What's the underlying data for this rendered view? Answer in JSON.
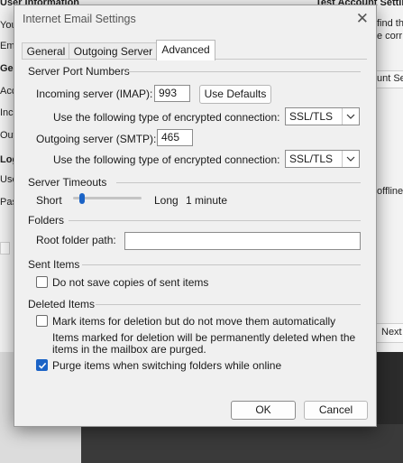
{
  "background": {
    "left_fragments": [
      "Your",
      "Emai",
      "Gene",
      "Acco",
      "Inco",
      "Outg",
      "Logo",
      "User",
      "Pass"
    ],
    "top_left_text": "User Information",
    "top_right_text": "Test Account Setting",
    "right_fragments": [
      "find tha",
      "e corr",
      "unt Sett",
      "offline"
    ],
    "next_button": "Next"
  },
  "dialog": {
    "title": "Internet Email Settings",
    "close_symbol": "✕",
    "tabs": [
      "General",
      "Outgoing Server",
      "Advanced"
    ],
    "active_tab": "Advanced",
    "server_ports": {
      "heading": "Server Port Numbers",
      "incoming_label": "Incoming server (IMAP):",
      "incoming_value": "993",
      "use_defaults": "Use Defaults",
      "encryption_label": "Use the following type of encrypted connection:",
      "incoming_encryption": "SSL/TLS",
      "outgoing_label": "Outgoing server (SMTP):",
      "outgoing_value": "465",
      "outgoing_encryption": "SSL/TLS"
    },
    "timeouts": {
      "heading": "Server Timeouts",
      "short": "Short",
      "long": "Long",
      "value": "1 minute",
      "slider_level": 0.1
    },
    "folders": {
      "heading": "Folders",
      "root_label": "Root folder path:",
      "root_value": ""
    },
    "sent_items": {
      "heading": "Sent Items",
      "dont_save_label": "Do not save copies of sent items",
      "dont_save_checked": false
    },
    "deleted_items": {
      "heading": "Deleted Items",
      "mark_label": "Mark items for deletion but do not move them automatically",
      "mark_checked": false,
      "note_line1": "Items marked for deletion will be permanently deleted when the",
      "note_line2": "items in the mailbox are purged.",
      "purge_label": "Purge items when switching folders while online",
      "purge_checked": true
    },
    "ok": "OK",
    "cancel": "Cancel"
  },
  "colors": {
    "accent": "#1b63c6",
    "dialog_bg": "#f0f0f0"
  }
}
